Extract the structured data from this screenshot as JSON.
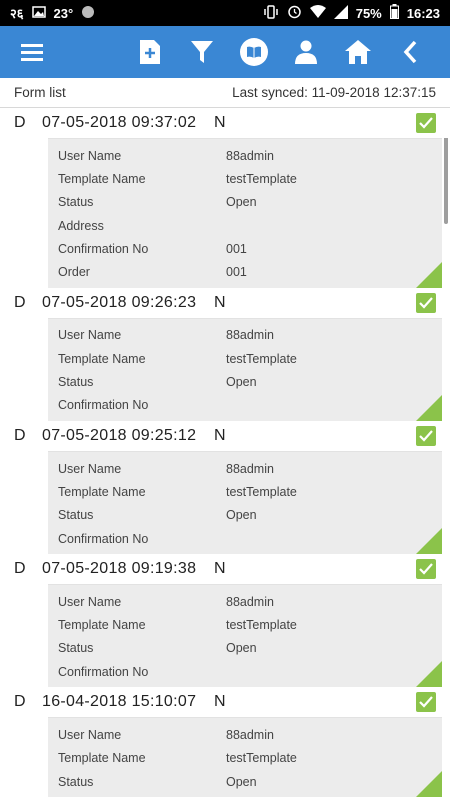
{
  "statusbar": {
    "left_icon_text": "२६",
    "temperature": "23°",
    "battery": "75%",
    "time": "16:23"
  },
  "appbar": {
    "icons": [
      "menu-icon",
      "add-form-icon",
      "filter-icon",
      "book-icon",
      "person-icon",
      "home-icon",
      "back-icon"
    ]
  },
  "subheader": {
    "title": "Form list",
    "last_synced": "Last synced: 11-09-2018 12:37:15"
  },
  "records": [
    {
      "type": "D",
      "datetime": "07-05-2018 09:37:02",
      "flag": "N",
      "fields": [
        {
          "label": "User Name",
          "value": "88admin"
        },
        {
          "label": "Template Name",
          "value": "testTemplate"
        },
        {
          "label": "Status",
          "value": "Open"
        },
        {
          "label": "Address",
          "value": ""
        },
        {
          "label": "Confirmation No",
          "value": "001"
        },
        {
          "label": "Order",
          "value": "001"
        }
      ]
    },
    {
      "type": "D",
      "datetime": "07-05-2018 09:26:23",
      "flag": "N",
      "fields": [
        {
          "label": "User Name",
          "value": "88admin"
        },
        {
          "label": "Template Name",
          "value": "testTemplate"
        },
        {
          "label": "Status",
          "value": "Open"
        },
        {
          "label": "Confirmation No",
          "value": ""
        }
      ]
    },
    {
      "type": "D",
      "datetime": "07-05-2018 09:25:12",
      "flag": "N",
      "fields": [
        {
          "label": "User Name",
          "value": "88admin"
        },
        {
          "label": "Template Name",
          "value": "testTemplate"
        },
        {
          "label": "Status",
          "value": "Open"
        },
        {
          "label": "Confirmation No",
          "value": ""
        }
      ]
    },
    {
      "type": "D",
      "datetime": "07-05-2018 09:19:38",
      "flag": "N",
      "fields": [
        {
          "label": "User Name",
          "value": "88admin"
        },
        {
          "label": "Template Name",
          "value": "testTemplate"
        },
        {
          "label": "Status",
          "value": "Open"
        },
        {
          "label": "Confirmation No",
          "value": ""
        }
      ]
    },
    {
      "type": "D",
      "datetime": "16-04-2018 15:10:07",
      "flag": "N",
      "fields": [
        {
          "label": "User Name",
          "value": "88admin"
        },
        {
          "label": "Template Name",
          "value": "testTemplate"
        },
        {
          "label": "Status",
          "value": "Open"
        }
      ]
    }
  ],
  "colors": {
    "appbar": "#3a87d4",
    "accent_green": "#8bc34a"
  }
}
